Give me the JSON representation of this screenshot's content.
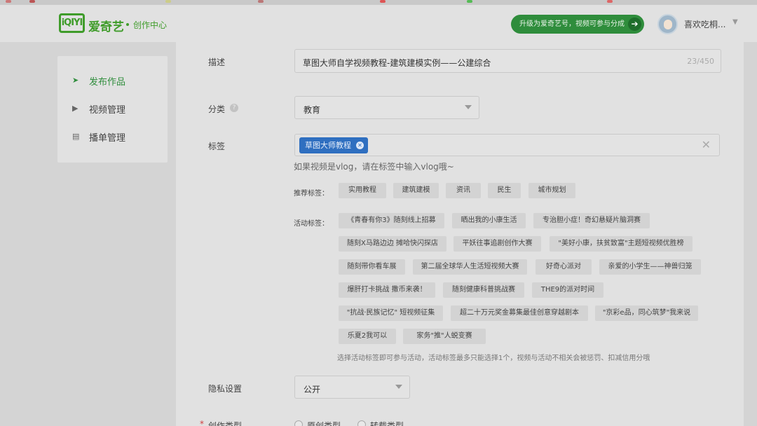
{
  "header": {
    "logo_text": "iQIYI",
    "brand": "爱奇艺",
    "sub_brand": "创作中心",
    "upgrade_label": "升级为爱奇艺号，视频可参与分成",
    "username": "喜欢吃桐..."
  },
  "sidebar": {
    "items": [
      {
        "label": "发布作品",
        "icon": "send-icon",
        "active": true
      },
      {
        "label": "视频管理",
        "icon": "play-square-icon",
        "active": false
      },
      {
        "label": "播单管理",
        "icon": "playlist-icon",
        "active": false
      }
    ]
  },
  "form": {
    "description": {
      "label": "描述",
      "value": "草图大师自学视频教程-建筑建模实例——公建综合",
      "count": "23/450"
    },
    "category": {
      "label": "分类",
      "value": "教育"
    },
    "tags": {
      "label": "标签",
      "chips": [
        "草图大师教程"
      ],
      "hint": "如果视频是vlog，请在标签中输入vlog哦~"
    },
    "recommended": {
      "label": "推荐标签：",
      "items": [
        "实用教程",
        "建筑建模",
        "资讯",
        "民生",
        "城市规划"
      ]
    },
    "activity": {
      "label": "活动标签：",
      "items": [
        "《青春有你3》随刻线上招募",
        "晒出我的小康生活",
        "专治胆小症！奇幻悬疑片脑洞赛",
        "随刻X马路边边 摊哈快闪探店",
        "平妖往事追剧创作大赛",
        "\"美好小康，扶贫致富\"主题短视频优胜榜",
        "随刻带你看车展",
        "第二届全球华人生活短视频大赛",
        "好奇心派对",
        "亲爱的小学生——神兽归笼",
        "爆肝打卡挑战 撒币来袭！",
        "随刻健康科普挑战赛",
        "THE9的派对时间",
        "\"抗战·民族记忆\" 短视频征集",
        "超二十万元奖金募集最佳创意穿越剧本",
        "\"京彩e品，同心筑梦\"我来说",
        "乐夏2我可以",
        "家务\"推\"人蜕变赛"
      ],
      "note": "选择活动标签即可参与活动，活动标签最多只能选择1个，视频与活动不相关会被惩罚、扣减信用分哦"
    },
    "privacy": {
      "label": "隐私设置",
      "value": "公开"
    },
    "creation_type": {
      "label": "创作类型",
      "options": [
        "原创类型",
        "转载类型"
      ]
    }
  }
}
